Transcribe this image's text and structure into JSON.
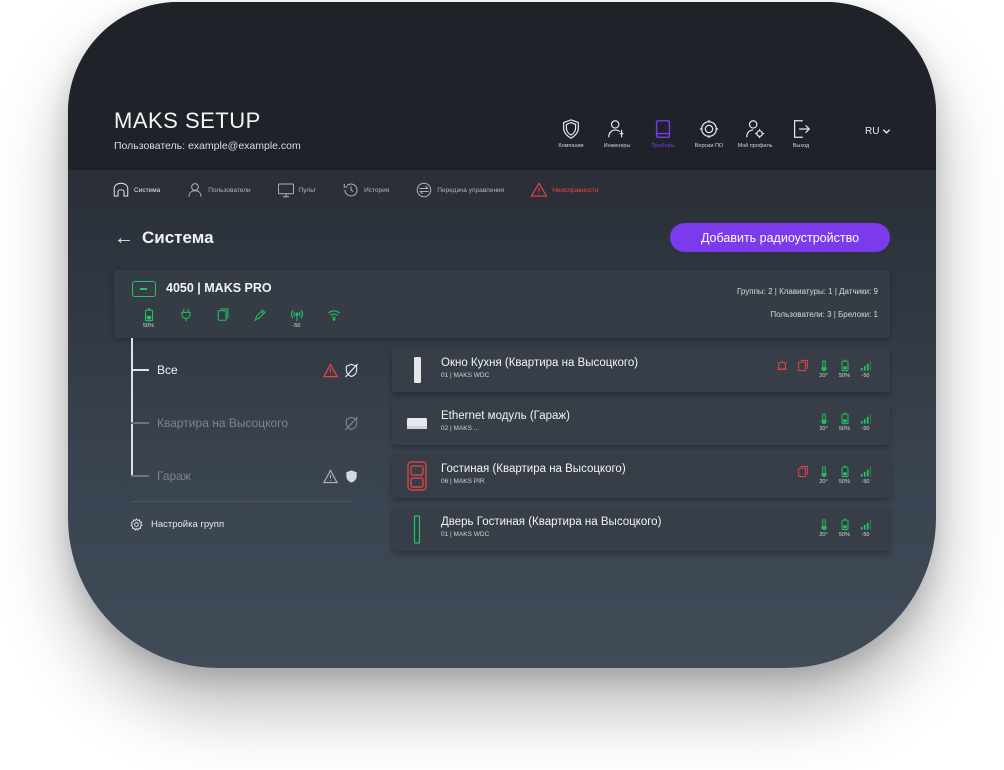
{
  "header": {
    "logo": "MAKS SETUP",
    "user": "Пользователь: example@example.com",
    "nav": [
      {
        "label": "Компании",
        "icon": "shield-icon"
      },
      {
        "label": "Инженеры",
        "icon": "engineer-icon"
      },
      {
        "label": "Приборы",
        "icon": "device-icon",
        "active": true
      },
      {
        "label": "Версии ПО",
        "icon": "firmware-icon"
      },
      {
        "label": "Мой профиль",
        "icon": "profile-icon"
      },
      {
        "label": "Выход",
        "icon": "logout-icon"
      }
    ],
    "lang": "RU"
  },
  "subnav": [
    {
      "label": "Система",
      "icon": "home-icon"
    },
    {
      "label": "Пользователи",
      "icon": "user-icon"
    },
    {
      "label": "Пульт",
      "icon": "monitor-icon"
    },
    {
      "label": "История",
      "icon": "history-icon"
    },
    {
      "label": "Передача управления",
      "icon": "transfer-icon"
    },
    {
      "label": "Неисправности",
      "icon": "warning-icon"
    }
  ],
  "page": {
    "back_arrow": "←",
    "title": "Система",
    "add_button": "Добавить радиоустройство"
  },
  "panel": {
    "name": "4050 | MAKS PRO",
    "icons": [
      {
        "name": "battery-icon",
        "value": "50%"
      },
      {
        "name": "power-plug-icon",
        "value": ""
      },
      {
        "name": "tamper-icon",
        "value": ""
      },
      {
        "name": "pen-icon",
        "value": ""
      },
      {
        "name": "radio-signal-icon",
        "value": "-50"
      },
      {
        "name": "wifi-icon",
        "value": ""
      }
    ],
    "stats_line1": "Группы: 2  |  Клавиатуры: 1  |  Датчики: 9",
    "stats_line2": "Пользователи: 3  |  Брелоки: 1"
  },
  "groups": [
    {
      "label": "Все"
    },
    {
      "label": "Квартира на Высоцкого"
    },
    {
      "label": "Гараж"
    }
  ],
  "group_settings": "Настройка групп",
  "devices": [
    {
      "name": "Окно Кухня (Квартира на Высоцкого)",
      "model": "01 | MAKS WDC",
      "temp": "20°",
      "battery": "50%",
      "signal": "-50"
    },
    {
      "name": "Ethernet модуль (Гараж)",
      "model": "02 | MAKS ...",
      "temp": "20°",
      "battery": "50%",
      "signal": "-50"
    },
    {
      "name": "Гостиная (Квартира на Высоцкого)",
      "model": "06 | MAKS PIR",
      "temp": "20°",
      "battery": "50%",
      "signal": "-50"
    },
    {
      "name": "Дверь Гостиная (Квартира на Высоцкого)",
      "model": "01 | MAKS WDC",
      "temp": "20°",
      "battery": "50%",
      "signal": "-50"
    }
  ],
  "colors": {
    "accent": "#7c3aed",
    "ok": "#22c55e",
    "alert": "#ef4444"
  }
}
